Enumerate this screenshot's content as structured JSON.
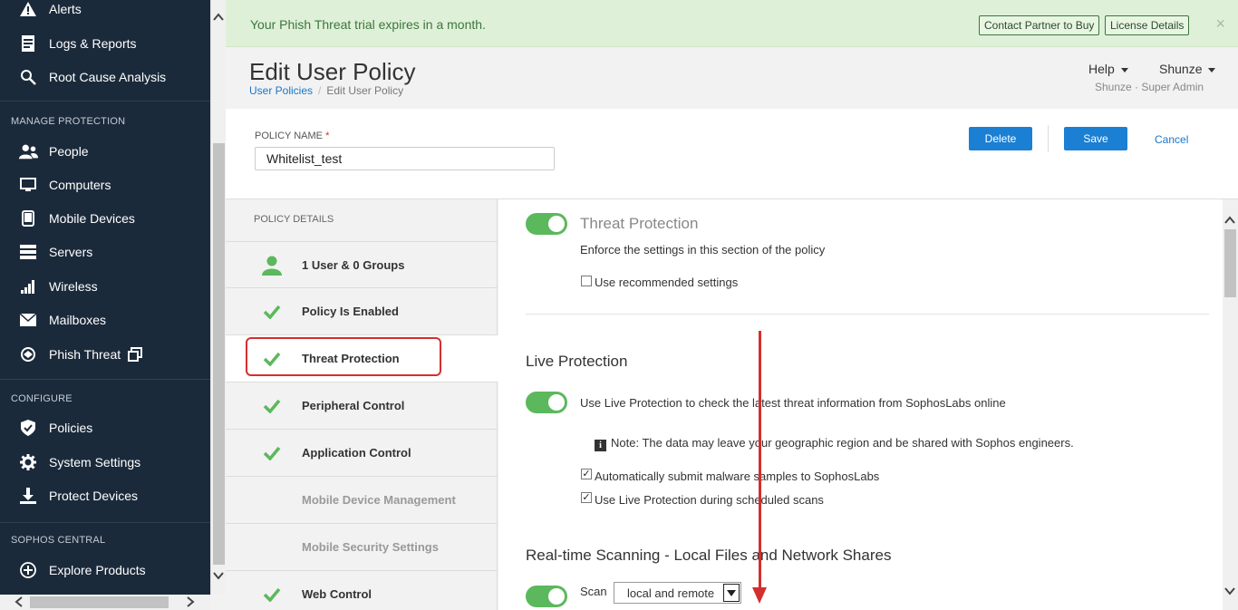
{
  "sidebar": {
    "top_items": [
      {
        "label": "Alerts",
        "icon": "warning-icon"
      },
      {
        "label": "Logs & Reports",
        "icon": "reports-icon"
      },
      {
        "label": "Root Cause Analysis",
        "icon": "magnifier-icon"
      }
    ],
    "sections": [
      {
        "title": "MANAGE PROTECTION",
        "items": [
          {
            "label": "People",
            "icon": "people-icon"
          },
          {
            "label": "Computers",
            "icon": "computer-icon"
          },
          {
            "label": "Mobile Devices",
            "icon": "mobile-icon"
          },
          {
            "label": "Servers",
            "icon": "server-icon"
          },
          {
            "label": "Wireless",
            "icon": "wireless-icon"
          },
          {
            "label": "Mailboxes",
            "icon": "mailbox-icon"
          },
          {
            "label": "Phish Threat",
            "icon": "fish-icon"
          }
        ]
      },
      {
        "title": "CONFIGURE",
        "items": [
          {
            "label": "Policies",
            "icon": "shield-icon"
          },
          {
            "label": "System Settings",
            "icon": "gear-icon"
          },
          {
            "label": "Protect Devices",
            "icon": "download-icon"
          }
        ]
      },
      {
        "title": "SOPHOS CENTRAL",
        "items": [
          {
            "label": "Explore Products",
            "icon": "plus-circle-icon"
          }
        ]
      }
    ]
  },
  "banner": {
    "message": "Your Phish Threat trial expires in a month.",
    "contact_label": "Contact Partner to Buy",
    "license_label": "License Details",
    "close": "×"
  },
  "header": {
    "title": "Edit User Policy",
    "breadcrumb_link": "User Policies",
    "breadcrumb_sep": "/",
    "breadcrumb_current": "Edit User Policy",
    "help_label": "Help",
    "user_label": "Shunze",
    "user_sub": "Shunze · Super Admin"
  },
  "policy": {
    "name_label": "POLICY NAME",
    "required_mark": "*",
    "name_value": "Whitelist_test",
    "delete_label": "Delete",
    "save_label": "Save",
    "cancel_label": "Cancel"
  },
  "details": {
    "header": "POLICY DETAILS",
    "rows": [
      {
        "label": "1 User  & 0 Groups",
        "icon": "user-icon",
        "enabled": true
      },
      {
        "label": "Policy Is Enabled",
        "icon": "check-icon",
        "enabled": true
      },
      {
        "label": "Threat Protection",
        "icon": "check-icon",
        "enabled": true,
        "active": true
      },
      {
        "label": "Peripheral Control",
        "icon": "check-icon",
        "enabled": true
      },
      {
        "label": "Application Control",
        "icon": "check-icon",
        "enabled": true
      },
      {
        "label": "Mobile Device Management",
        "icon": "",
        "enabled": false
      },
      {
        "label": "Mobile Security Settings",
        "icon": "",
        "enabled": false
      },
      {
        "label": "Web Control",
        "icon": "check-icon",
        "enabled": true
      }
    ]
  },
  "content": {
    "threat_title": "Threat Protection",
    "enforce_text": "Enforce the settings in this section of the policy",
    "recommended_label": "Use recommended settings",
    "recommended_checked": false,
    "live_title": "Live Protection",
    "live_text": "Use Live Protection to check the latest threat information from SophosLabs online",
    "note_icon": "i",
    "note_text": "Note: The data may leave your geographic region and be shared with Sophos engineers.",
    "auto_submit_label": "Automatically submit malware samples to SophosLabs",
    "auto_submit_checked": true,
    "scheduled_label": "Use Live Protection during scheduled scans",
    "scheduled_checked": true,
    "realtime_title": "Real-time Scanning - Local Files and Network Shares",
    "scan_label": "Scan",
    "scan_value": "local and remote"
  },
  "colors": {
    "sidebar_bg": "#1b2a3b",
    "accent_blue": "#1b7fd3",
    "toggle_green": "#5cb85c",
    "annotation_red": "#d32f2f",
    "banner_bg": "#dff0d8"
  }
}
